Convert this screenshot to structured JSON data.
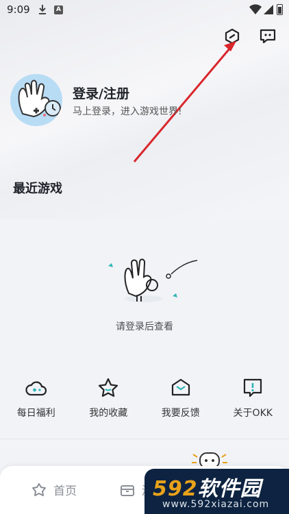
{
  "status_bar": {
    "time": "9:09",
    "notification_icons": [
      "download-icon",
      "a-app-icon"
    ],
    "system_icons": [
      "wifi-icon",
      "signal-icon",
      "battery-icon"
    ]
  },
  "header": {
    "icons": [
      "settings-hexagon-icon",
      "feedback-message-icon"
    ]
  },
  "profile": {
    "title": "登录/注册",
    "subtitle": "马上登录，进入游戏世界!"
  },
  "recent": {
    "title": "最近游戏",
    "empty_text": "请登录后查看"
  },
  "shortcuts": [
    {
      "label": "每日福利",
      "icon": "gamepad-cloud-icon"
    },
    {
      "label": "我的收藏",
      "icon": "star-icon"
    },
    {
      "label": "我要反馈",
      "icon": "envelope-icon"
    },
    {
      "label": "关于OKK",
      "icon": "exclamation-bubble-icon"
    }
  ],
  "tabbar": {
    "home_label": "首页",
    "second_label_partial": "游"
  },
  "watermark": {
    "brand_number": "592",
    "brand_text": "软件园",
    "url": "www.592xiazai.com"
  },
  "colors": {
    "accent": "#2bb5b5",
    "annotation_arrow": "#d9262c",
    "watermark_bg": "#0d2341"
  }
}
